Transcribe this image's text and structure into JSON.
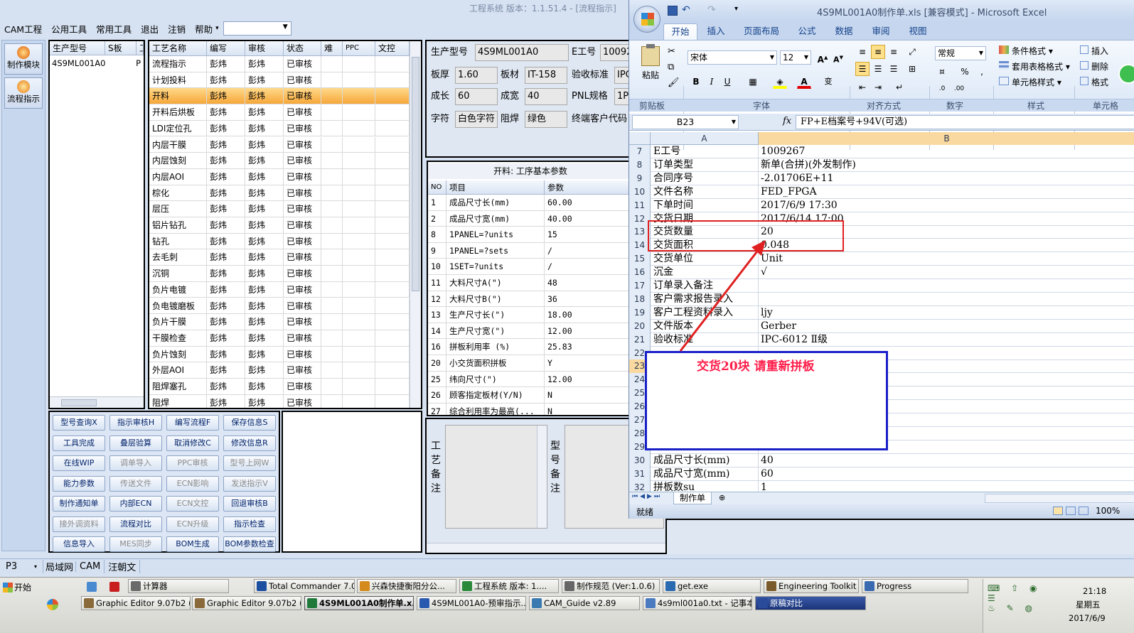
{
  "cam": {
    "title": "工程系统  版本：1.1.51.4 - [流程指示]",
    "menu": [
      "CAM工程",
      "公用工具",
      "常用工具",
      "退出",
      "注销",
      "帮助"
    ],
    "side_buttons": [
      {
        "label": "制作模块",
        "icon": "module-icon"
      },
      {
        "label": "流程指示",
        "icon": "flow-icon"
      }
    ],
    "model_list": {
      "headers": [
        "生产型号",
        "S板",
        "工"
      ],
      "rows": [
        [
          "4S9ML001A0",
          "",
          "P"
        ]
      ]
    },
    "process": {
      "headers": [
        "工艺名称",
        "编写",
        "审核",
        "状态",
        "难",
        "PPC",
        "文控"
      ],
      "rows": [
        [
          "流程指示",
          "彭炜",
          "彭炜",
          "已审核"
        ],
        [
          "计划投料",
          "彭炜",
          "彭炜",
          "已审核"
        ],
        [
          "开料",
          "彭炜",
          "彭炜",
          "已审核"
        ],
        [
          "开料后烘板",
          "彭炜",
          "彭炜",
          "已审核"
        ],
        [
          "LDI定位孔",
          "彭炜",
          "彭炜",
          "已审核"
        ],
        [
          "内层干膜",
          "彭炜",
          "彭炜",
          "已审核"
        ],
        [
          "内层蚀刻",
          "彭炜",
          "彭炜",
          "已审核"
        ],
        [
          "内层AOI",
          "彭炜",
          "彭炜",
          "已审核"
        ],
        [
          "棕化",
          "彭炜",
          "彭炜",
          "已审核"
        ],
        [
          "层压",
          "彭炜",
          "彭炜",
          "已审核"
        ],
        [
          "铝片钻孔",
          "彭炜",
          "彭炜",
          "已审核"
        ],
        [
          "钻孔",
          "彭炜",
          "彭炜",
          "已审核"
        ],
        [
          "去毛刺",
          "彭炜",
          "彭炜",
          "已审核"
        ],
        [
          "沉铜",
          "彭炜",
          "彭炜",
          "已审核"
        ],
        [
          "负片电镀",
          "彭炜",
          "彭炜",
          "已审核"
        ],
        [
          "负电镀磨板",
          "彭炜",
          "彭炜",
          "已审核"
        ],
        [
          "负片干膜",
          "彭炜",
          "彭炜",
          "已审核"
        ],
        [
          "干膜检查",
          "彭炜",
          "彭炜",
          "已审核"
        ],
        [
          "负片蚀刻",
          "彭炜",
          "彭炜",
          "已审核"
        ],
        [
          "外层AOI",
          "彭炜",
          "彭炜",
          "已审核"
        ],
        [
          "阻焊塞孔",
          "彭炜",
          "彭炜",
          "已审核"
        ],
        [
          "阻焊",
          "彭炜",
          "彭炜",
          "已审核"
        ]
      ],
      "selected_index": 2
    },
    "buttons": [
      [
        "型号查询X",
        "指示审核H",
        "编写流程F",
        "保存信息S"
      ],
      [
        "工具完成",
        "叠层验算",
        "取消修改C",
        "修改信息R"
      ],
      [
        "在线WIP",
        "调单导入",
        "PPC审核",
        "型号上网W"
      ],
      [
        "能力参数",
        "传送文件",
        "ECN影响",
        "发送指示V"
      ],
      [
        "制作通知单",
        "内部ECN",
        "ECN文控",
        "回退审核B"
      ],
      [
        "接外调资料",
        "流程对比",
        "ECN升级",
        "指示检查"
      ],
      [
        "信息导入",
        "MES同步",
        "BOM生成",
        "BOM参数检查"
      ]
    ],
    "disabled_buttons": [
      "调单导入",
      "PPC审核",
      "型号上网W",
      "传送文件",
      "ECN影响",
      "发送指示V",
      "ECN文控",
      "接外调资料",
      "ECN升级",
      "MES同步"
    ],
    "info": {
      "row1": [
        {
          "label": "生产型号",
          "value": "4S9ML001A0"
        },
        {
          "label": "E工号",
          "value": "10092"
        }
      ],
      "row2": [
        {
          "label": "板厚",
          "value": "1.60"
        },
        {
          "label": "板材",
          "value": "IT-158"
        },
        {
          "label": "验收标准",
          "value": "IPC"
        }
      ],
      "row3": [
        {
          "label": "成长",
          "value": "60"
        },
        {
          "label": "成宽",
          "value": "40"
        },
        {
          "label": "PNL规格",
          "value": "1P"
        }
      ],
      "row4": [
        {
          "label": "字符",
          "value": "白色字符"
        },
        {
          "label": "阻焊",
          "value": "绿色"
        },
        {
          "label": "终端客户代码",
          "value": ""
        }
      ]
    },
    "params": {
      "title": "开料: 工序基本参数",
      "headers": [
        "NO",
        "项目",
        "参数"
      ],
      "rows": [
        [
          "1",
          "成品尺寸长(mm)",
          "60.00"
        ],
        [
          "2",
          "成品尺寸宽(mm)",
          "40.00"
        ],
        [
          "8",
          "1PANEL=?units",
          "15"
        ],
        [
          "9",
          "1PANEL=?sets",
          "/"
        ],
        [
          "10",
          "1SET=?units",
          "/"
        ],
        [
          "11",
          "大料尺寸A(\")",
          "48"
        ],
        [
          "12",
          "大料尺寸B(\")",
          "36"
        ],
        [
          "13",
          "生产尺寸长(\")",
          "18.00"
        ],
        [
          "14",
          "生产尺寸宽(\")",
          "12.00"
        ],
        [
          "16",
          "拼板利用率 (%)",
          "25.83"
        ],
        [
          "20",
          "小交货面积拼板",
          "Y"
        ],
        [
          "25",
          "纬向尺寸(\")",
          "12.00"
        ],
        [
          "26",
          "顾客指定板材(Y/N)",
          "N"
        ],
        [
          "27",
          "综合利用率为最高(...",
          "N"
        ]
      ]
    },
    "note_labels": [
      "工艺备注",
      "型号备注"
    ],
    "status": {
      "p3": "P3",
      "tabs": [
        "局域网",
        "CAM",
        "汪朝文"
      ]
    }
  },
  "excel": {
    "title": "4S9ML001A0制作单.xls  [兼容模式] - Microsoft Excel",
    "tabs": [
      "开始",
      "插入",
      "页面布局",
      "公式",
      "数据",
      "审阅",
      "视图"
    ],
    "active_tab": "开始",
    "font_name": "宋体",
    "font_size": "12",
    "number_format": "常规",
    "group_labels": [
      "剪贴板",
      "字体",
      "对齐方式",
      "数字",
      "样式",
      "单元格"
    ],
    "paste_label": "粘贴",
    "style_items": [
      "条件格式",
      "套用表格格式",
      "单元格样式"
    ],
    "cell_items": [
      "插入",
      "删除",
      "格式"
    ],
    "name_box": "B23",
    "formula": "FP+E档案号+94V(可选)",
    "col_headers": [
      "A",
      "B"
    ],
    "rows": [
      {
        "n": "7",
        "a": "E工号",
        "b": "1009267"
      },
      {
        "n": "8",
        "a": "订单类型",
        "b": "新单(合拼)(外发制作)"
      },
      {
        "n": "9",
        "a": "合同序号",
        "b": "-2.01706E+11"
      },
      {
        "n": "10",
        "a": "文件名称",
        "b": "FED_FPGA"
      },
      {
        "n": "11",
        "a": "下单时间",
        "b": "2017/6/9 17:30"
      },
      {
        "n": "12",
        "a": "交货日期",
        "b": "2017/6/14 17:00"
      },
      {
        "n": "13",
        "a": "交货数量",
        "b": "20"
      },
      {
        "n": "14",
        "a": "交货面积",
        "b": "0.048"
      },
      {
        "n": "15",
        "a": "交货单位",
        "b": "Unit"
      },
      {
        "n": "16",
        "a": "沉金",
        "b": "√"
      },
      {
        "n": "17",
        "a": "订单录入备注",
        "b": ""
      },
      {
        "n": "18",
        "a": "客户需求报告录入",
        "b": ""
      },
      {
        "n": "19",
        "a": "客户工程资料录入",
        "b": "ljy"
      },
      {
        "n": "20",
        "a": "文件版本",
        "b": "Gerber"
      },
      {
        "n": "21",
        "a": "验收标准",
        "b": "IPC-6012 Ⅱ级"
      },
      {
        "n": "22",
        "a": "",
        "b": ""
      },
      {
        "n": "23",
        "a": "",
        "b": ""
      },
      {
        "n": "24",
        "a": "",
        "b": ""
      },
      {
        "n": "25",
        "a": "",
        "b": ""
      },
      {
        "n": "26",
        "a": "",
        "b": ""
      },
      {
        "n": "27",
        "a": "",
        "b": ""
      },
      {
        "n": "28",
        "a": "",
        "b": ""
      },
      {
        "n": "29",
        "a": "",
        "b": ""
      },
      {
        "n": "30",
        "a": "成品尺寸长(mm)",
        "b": "40"
      },
      {
        "n": "31",
        "a": "成品尺寸宽(mm)",
        "b": "60"
      },
      {
        "n": "32",
        "a": "拼板数su",
        "b": "1"
      }
    ],
    "sheet_tab": "制作单",
    "status_text": "就绪",
    "zoom": "100%",
    "annotation": "交货20块  请重新拼板"
  },
  "taskbar": {
    "start": "开始",
    "row1": [
      {
        "label": "计算器",
        "color": "#6a6a6a"
      },
      {
        "label": "Total Commander 7.0...",
        "color": "#1c4fa0"
      },
      {
        "label": "兴森快捷衡阳分公...",
        "color": "#d48a1c"
      },
      {
        "label": "工程系统  版本: 1....",
        "color": "#2a8a3a"
      },
      {
        "label": "制作规范 (Ver:1.0.6)",
        "color": "#666"
      },
      {
        "label": "get.exe",
        "color": "#2a6ab0"
      },
      {
        "label": "Engineering Toolkit 9....",
        "color": "#7a5a2a"
      },
      {
        "label": "Progress",
        "color": "#3a6ab0"
      }
    ],
    "row2": [
      {
        "label": "Graphic Editor 9.07b2 (0...",
        "color": "#8a6a3a"
      },
      {
        "label": "Graphic Editor 9.07b2 (0...",
        "color": "#8a6a3a"
      },
      {
        "label": "4S9ML001A0制作单.x...",
        "color": "#1f7a3a",
        "active": true
      },
      {
        "label": "4S9ML001A0-预审指示...",
        "color": "#2a5ab0"
      },
      {
        "label": "CAM_Guide v2.89",
        "color": "#3a7ab0"
      },
      {
        "label": "4s9ml001a0.txt - 记事本",
        "color": "#4a7ac0"
      },
      {
        "label": "原稿对比",
        "color": "#2a4a9a",
        "dark": true
      }
    ],
    "time": "21:18",
    "weekday": "星期五",
    "date": "2017/6/9"
  }
}
